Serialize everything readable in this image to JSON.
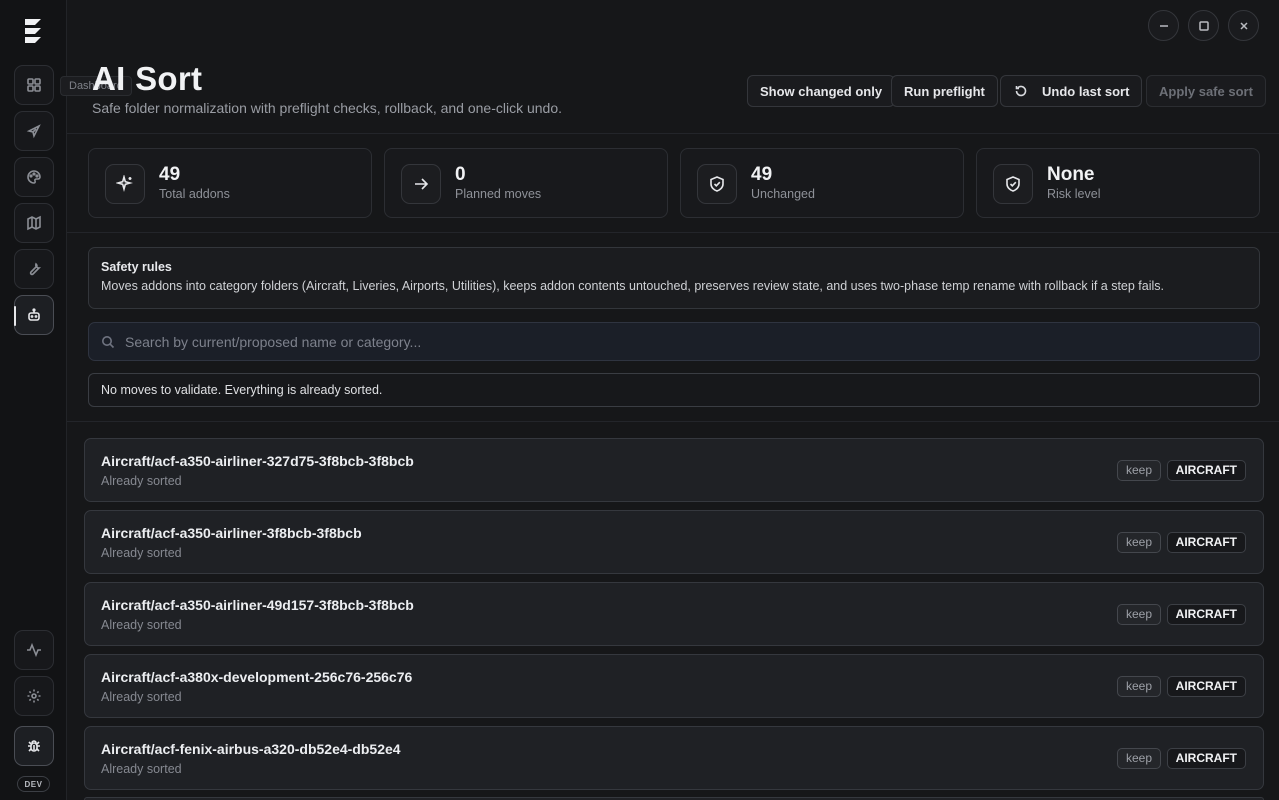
{
  "sidebar": {
    "items": [
      {
        "icon": "dashboard-icon",
        "name": "sidebar-item-dashboard"
      },
      {
        "icon": "plane-icon",
        "name": "sidebar-item-aircraft"
      },
      {
        "icon": "palette-icon",
        "name": "sidebar-item-liveries"
      },
      {
        "icon": "map-icon",
        "name": "sidebar-item-map"
      },
      {
        "icon": "wrench-icon",
        "name": "sidebar-item-tools"
      },
      {
        "icon": "bot-icon",
        "name": "sidebar-item-ai-sort"
      }
    ],
    "bottom": [
      {
        "icon": "activity-icon"
      },
      {
        "icon": "gear-icon"
      },
      {
        "icon": "bug-icon"
      }
    ],
    "tooltip": "Dashboard",
    "dev_badge": "DEV"
  },
  "header": {
    "title": "AI Sort",
    "subtitle": "Safe folder normalization with preflight checks, rollback, and one-click undo.",
    "buttons": {
      "show_changed": "Show changed only",
      "run_preflight": "Run preflight",
      "undo_last": "Undo last sort",
      "apply_safe": "Apply safe sort"
    }
  },
  "stats": [
    {
      "value": "49",
      "label": "Total addons",
      "icon": "sparkles-icon"
    },
    {
      "value": "0",
      "label": "Planned moves",
      "icon": "arrow-right-icon"
    },
    {
      "value": "49",
      "label": "Unchanged",
      "icon": "shield-check-icon"
    },
    {
      "value": "None",
      "label": "Risk level",
      "icon": "shield-check-icon"
    }
  ],
  "safety_rules": {
    "title": "Safety rules",
    "text": "Moves addons into category folders (Aircraft, Liveries, Airports, Utilities), keeps addon contents untouched, preserves review state, and uses two-phase temp rename with rollback if a step fails."
  },
  "search": {
    "placeholder": "Search by current/proposed name or category...",
    "value": ""
  },
  "validation_message": "No moves to validate. Everything is already sorted.",
  "rows": [
    {
      "path": "Aircraft/acf-a350-airliner-327d75-3f8bcb-3f8bcb",
      "status": "Already sorted",
      "action": "keep",
      "category": "AIRCRAFT"
    },
    {
      "path": "Aircraft/acf-a350-airliner-3f8bcb-3f8bcb",
      "status": "Already sorted",
      "action": "keep",
      "category": "AIRCRAFT"
    },
    {
      "path": "Aircraft/acf-a350-airliner-49d157-3f8bcb-3f8bcb",
      "status": "Already sorted",
      "action": "keep",
      "category": "AIRCRAFT"
    },
    {
      "path": "Aircraft/acf-a380x-development-256c76-256c76",
      "status": "Already sorted",
      "action": "keep",
      "category": "AIRCRAFT"
    },
    {
      "path": "Aircraft/acf-fenix-airbus-a320-db52e4-db52e4",
      "status": "Already sorted",
      "action": "keep",
      "category": "AIRCRAFT"
    }
  ]
}
